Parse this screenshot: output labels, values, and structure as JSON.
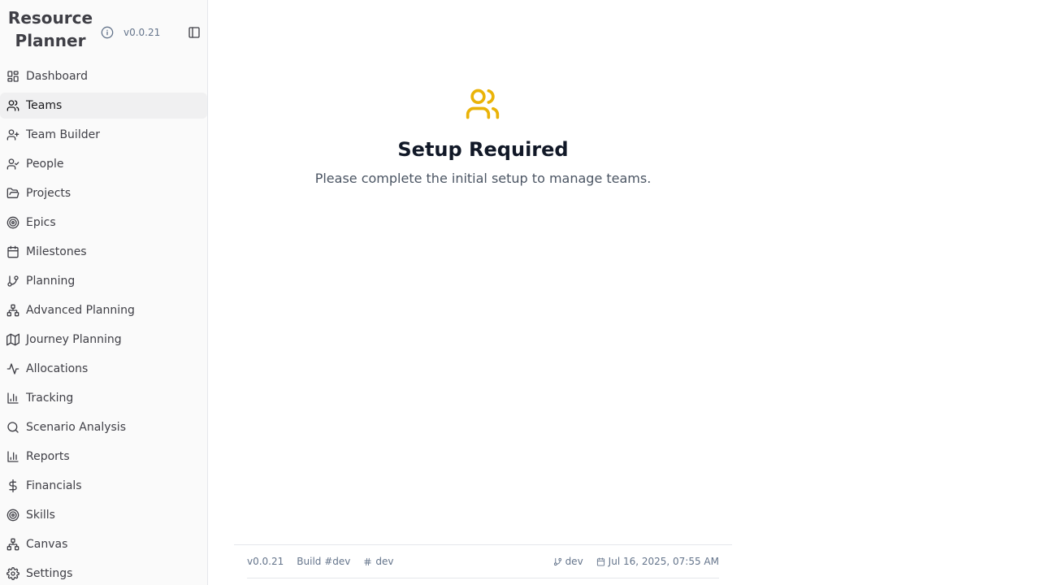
{
  "sidebar": {
    "brand": "Resource Planner",
    "version": "v0.0.21",
    "items": [
      {
        "label": "Dashboard"
      },
      {
        "label": "Teams"
      },
      {
        "label": "Team Builder"
      },
      {
        "label": "People"
      },
      {
        "label": "Projects"
      },
      {
        "label": "Epics"
      },
      {
        "label": "Milestones"
      },
      {
        "label": "Planning"
      },
      {
        "label": "Advanced Planning"
      },
      {
        "label": "Journey Planning"
      },
      {
        "label": "Allocations"
      },
      {
        "label": "Tracking"
      },
      {
        "label": "Scenario Analysis"
      },
      {
        "label": "Reports"
      },
      {
        "label": "Financials"
      },
      {
        "label": "Skills"
      },
      {
        "label": "Canvas"
      },
      {
        "label": "Settings"
      }
    ]
  },
  "main": {
    "title": "Setup Required",
    "description": "Please complete the initial setup to manage teams.",
    "icon": "users-icon",
    "icon_color": "#eab308"
  },
  "footer": {
    "version": "v0.0.21",
    "build": "Build #dev",
    "hash": "dev",
    "branch": "dev",
    "date": "Jul 16, 2025, 07:55 AM"
  }
}
